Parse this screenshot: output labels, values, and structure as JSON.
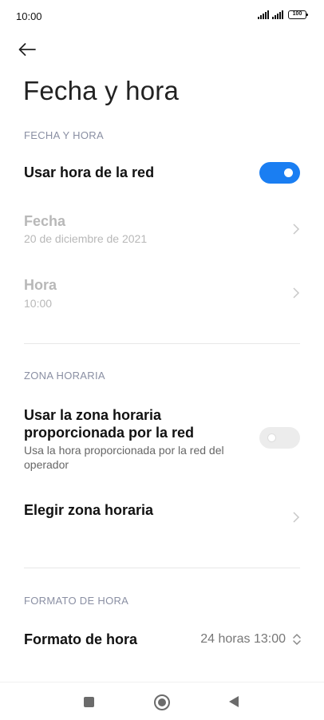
{
  "status_bar": {
    "time": "10:00",
    "battery": "100"
  },
  "page": {
    "title": "Fecha y hora"
  },
  "sections": {
    "date_time": {
      "header": "FECHA Y HORA",
      "network_time": {
        "label": "Usar hora de la red",
        "enabled": true
      },
      "date": {
        "label": "Fecha",
        "value": "20 de diciembre de 2021"
      },
      "time": {
        "label": "Hora",
        "value": "10:00"
      }
    },
    "time_zone": {
      "header": "ZONA HORARIA",
      "network_zone": {
        "label_line1": "Usar la zona horaria",
        "label_line2": "proporcionada por la red",
        "description_line1": "Usa la hora proporcionada por la red del",
        "description_line2": "operador",
        "enabled": false
      },
      "choose_zone": {
        "label": "Elegir zona horaria"
      }
    },
    "time_format": {
      "header": "FORMATO DE HORA",
      "format": {
        "label": "Formato de hora",
        "value": "24 horas 13:00"
      }
    }
  },
  "colors": {
    "accent": "#1a7ef2",
    "section_header": "#8a8fa3",
    "disabled_text": "#b8b8b8"
  },
  "icons": [
    "signal-icon",
    "battery-icon",
    "back-arrow-icon",
    "chevron-right-icon",
    "up-down-icon",
    "recents-icon",
    "home-icon",
    "nav-back-icon"
  ]
}
